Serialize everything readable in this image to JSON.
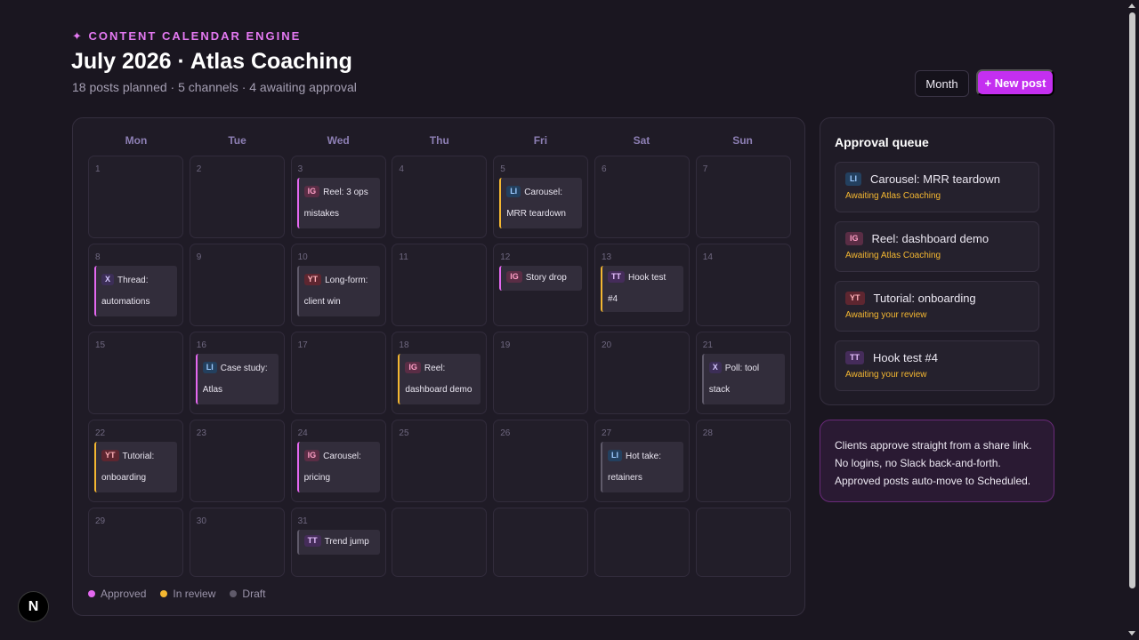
{
  "header": {
    "eyebrow": "✦ CONTENT CALENDAR ENGINE",
    "title": "July 2026 · Atlas Coaching",
    "subtitle": "18 posts planned · 5 channels · 4 awaiting approval",
    "view_label": "Month",
    "new_post_label": "+ New post"
  },
  "calendar": {
    "weekdays": [
      "Mon",
      "Tue",
      "Wed",
      "Thu",
      "Fri",
      "Sat",
      "Sun"
    ],
    "days": [
      {
        "n": "1"
      },
      {
        "n": "2"
      },
      {
        "n": "3",
        "post": {
          "badge": "IG",
          "title": "Reel: 3 ops mistakes",
          "status": "approved"
        }
      },
      {
        "n": "4"
      },
      {
        "n": "5",
        "post": {
          "badge": "LI",
          "title": "Carousel: MRR teardown",
          "status": "review"
        }
      },
      {
        "n": "6"
      },
      {
        "n": "7"
      },
      {
        "n": "8",
        "post": {
          "badge": "X",
          "title": "Thread: automations",
          "status": "approved"
        }
      },
      {
        "n": "9"
      },
      {
        "n": "10",
        "post": {
          "badge": "YT",
          "title": "Long-form: client win",
          "status": "draft"
        }
      },
      {
        "n": "11"
      },
      {
        "n": "12",
        "post": {
          "badge": "IG",
          "title": "Story drop",
          "status": "approved"
        }
      },
      {
        "n": "13",
        "post": {
          "badge": "TT",
          "title": "Hook test #4",
          "status": "review"
        }
      },
      {
        "n": "14"
      },
      {
        "n": "15"
      },
      {
        "n": "16",
        "post": {
          "badge": "LI",
          "title": "Case study: Atlas",
          "status": "approved"
        }
      },
      {
        "n": "17"
      },
      {
        "n": "18",
        "post": {
          "badge": "IG",
          "title": "Reel: dashboard demo",
          "status": "review"
        }
      },
      {
        "n": "19"
      },
      {
        "n": "20"
      },
      {
        "n": "21",
        "post": {
          "badge": "X",
          "title": "Poll: tool stack",
          "status": "draft"
        }
      },
      {
        "n": "22",
        "post": {
          "badge": "YT",
          "title": "Tutorial: onboarding",
          "status": "review"
        }
      },
      {
        "n": "23"
      },
      {
        "n": "24",
        "post": {
          "badge": "IG",
          "title": "Carousel: pricing",
          "status": "approved"
        }
      },
      {
        "n": "25"
      },
      {
        "n": "26"
      },
      {
        "n": "27",
        "post": {
          "badge": "LI",
          "title": "Hot take: retainers",
          "status": "draft"
        }
      },
      {
        "n": "28"
      },
      {
        "n": "29"
      },
      {
        "n": "30"
      },
      {
        "n": "31",
        "post": {
          "badge": "TT",
          "title": "Trend jump",
          "status": "draft"
        }
      },
      {
        "n": ""
      },
      {
        "n": ""
      },
      {
        "n": ""
      },
      {
        "n": ""
      }
    ],
    "legend": [
      {
        "label": "Approved",
        "color": "#e468f0"
      },
      {
        "label": "In review",
        "color": "#f4b731"
      },
      {
        "label": "Draft",
        "color": "#5f5a6a"
      }
    ]
  },
  "approval_queue": {
    "title": "Approval queue",
    "items": [
      {
        "badge": "LI",
        "title": "Carousel: MRR teardown",
        "status": "Awaiting Atlas Coaching"
      },
      {
        "badge": "IG",
        "title": "Reel: dashboard demo",
        "status": "Awaiting Atlas Coaching"
      },
      {
        "badge": "YT",
        "title": "Tutorial: onboarding",
        "status": "Awaiting your review"
      },
      {
        "badge": "TT",
        "title": "Hook test #4",
        "status": "Awaiting your review"
      }
    ]
  },
  "note": {
    "lines": [
      "Clients approve straight from a share link.",
      "No logins, no Slack back-and-forth.",
      "Approved posts auto-move to Scheduled."
    ]
  },
  "dev_badge": "N",
  "colors": {
    "background": "#1a1620",
    "accent": "#c42ff0",
    "approved": "#e468f0",
    "review": "#f4b731",
    "draft": "#5f5a6a"
  }
}
